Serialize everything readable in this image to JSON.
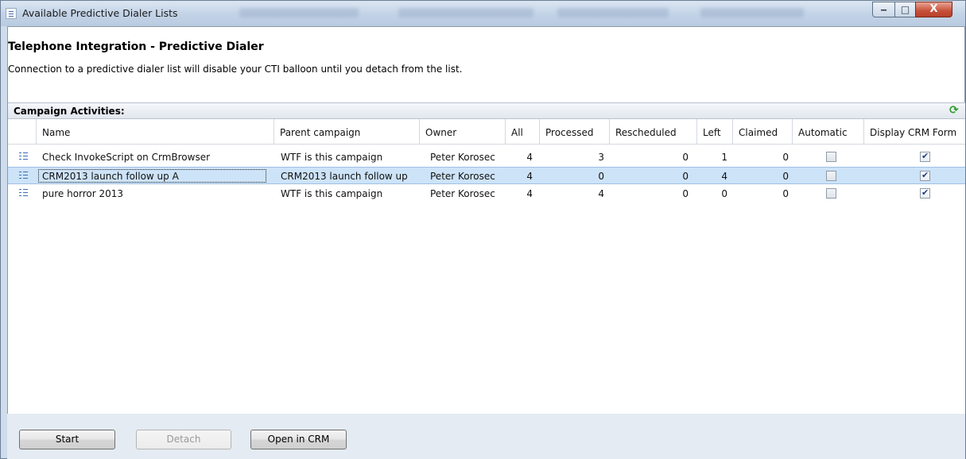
{
  "window": {
    "title": "Available Predictive Dialer Lists",
    "controls": {
      "minimize": "‒",
      "maximize": "□",
      "close": "X"
    }
  },
  "header": {
    "title": "Telephone Integration - Predictive Dialer",
    "description": "Connection to a predictive dialer list will disable your CTI balloon until you detach from the list."
  },
  "section": {
    "label": "Campaign Activities:",
    "refresh_icon": "refresh-icon"
  },
  "table": {
    "columns": [
      "",
      "Name",
      "Parent campaign",
      "Owner",
      "All",
      "Processed",
      "Rescheduled",
      "Left",
      "Claimed",
      "Automatic",
      "Display CRM Form"
    ],
    "rows": [
      {
        "name": "Check InvokeScript on CrmBrowser",
        "parent": "WTF is this campaign",
        "owner": "Peter Korosec",
        "all": "4",
        "processed": "3",
        "rescheduled": "0",
        "left": "1",
        "claimed": "0",
        "automatic": false,
        "display_crm_form": true,
        "selected": false
      },
      {
        "name": "CRM2013 launch follow up A",
        "parent": "CRM2013 launch follow up",
        "owner": "Peter Korosec",
        "all": "4",
        "processed": "0",
        "rescheduled": "0",
        "left": "4",
        "claimed": "0",
        "automatic": false,
        "display_crm_form": true,
        "selected": true
      },
      {
        "name": "pure horror 2013",
        "parent": "WTF is this campaign",
        "owner": "Peter Korosec",
        "all": "4",
        "processed": "4",
        "rescheduled": "0",
        "left": "0",
        "claimed": "0",
        "automatic": false,
        "display_crm_form": true,
        "selected": false
      }
    ]
  },
  "buttons": {
    "start": "Start",
    "detach": "Detach",
    "open_in_crm": "Open in CRM"
  },
  "colors": {
    "selection": "#cde3f8",
    "accent": "#3a6fb8",
    "refresh": "#2d9c2d"
  }
}
